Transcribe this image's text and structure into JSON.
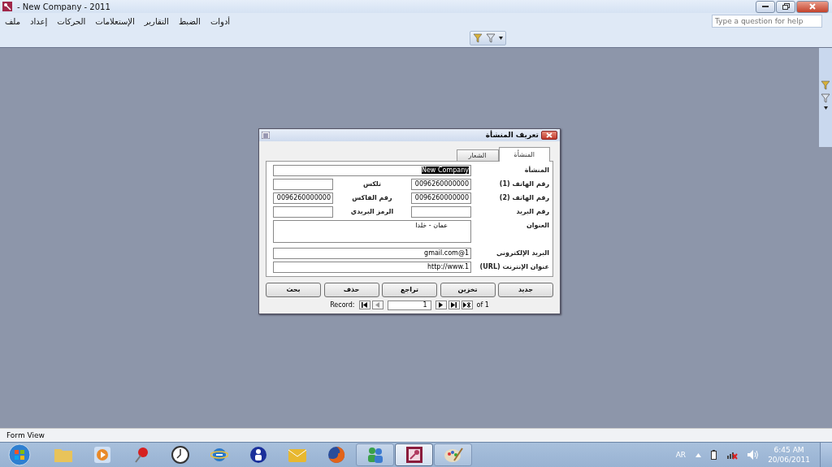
{
  "window": {
    "title": "- New Company - 2011"
  },
  "menu": [
    "أدوات",
    "الضبط",
    "التقارير",
    "الإستعلامات",
    "الحركات",
    "إعداد",
    "ملف"
  ],
  "help": {
    "placeholder": "Type a question for help"
  },
  "form": {
    "title": "تعريف المنشأة",
    "tabs": [
      {
        "label": "المنشأة",
        "selected": true
      },
      {
        "label": "الشعار",
        "selected": false
      }
    ],
    "rows": [
      {
        "kind": "wide",
        "label": "المنشأة",
        "value": "New Company",
        "text_selected": true
      },
      {
        "kind": "pair",
        "fields": [
          {
            "label": "رقم الهاتف (1)",
            "value": "0096260000000"
          },
          {
            "label": "تلكس"
          }
        ]
      },
      {
        "kind": "pair",
        "fields": [
          {
            "label": "رقم الهاتف (2)",
            "value": "0096260000000"
          },
          {
            "label": "رقم الفاكس",
            "value": "0096260000000"
          }
        ]
      },
      {
        "kind": "pair",
        "fields": [
          {
            "label": "رقم البريد"
          },
          {
            "label": "الرمز البريدي"
          }
        ]
      },
      {
        "kind": "multiline",
        "label": "العنوان",
        "value": "عمان - خلدا"
      },
      {
        "kind": "wide",
        "label": "البريد الإلكتروني",
        "value": "gmail.com@1",
        "text_selected": false
      },
      {
        "kind": "wide",
        "label": "عنوان الإنترنت (URL)",
        "value": "http://www.1",
        "text_selected": false
      }
    ],
    "buttons": [
      "جديد",
      "تخزين",
      "تراجع",
      "حذف",
      "بحث"
    ],
    "record": {
      "label": "Record:",
      "value": "1",
      "total": "of 1"
    }
  },
  "status_bar": "Form View",
  "taskbar": [
    {
      "kind": "folder",
      "running": false,
      "selected": false
    },
    {
      "kind": "media",
      "running": false,
      "selected": false
    },
    {
      "kind": "pin",
      "running": false,
      "selected": false
    },
    {
      "kind": "clock",
      "running": false,
      "selected": false
    },
    {
      "kind": "browser",
      "running": false,
      "selected": false
    },
    {
      "kind": "user",
      "running": false,
      "selected": false
    },
    {
      "kind": "mail",
      "running": false,
      "selected": false
    },
    {
      "kind": "firefox",
      "running": false,
      "selected": false
    },
    {
      "kind": "messenger",
      "running": true,
      "selected": false
    },
    {
      "kind": "access",
      "running": true,
      "selected": true
    },
    {
      "kind": "paint",
      "running": true,
      "selected": false
    }
  ],
  "tray": {
    "language": "AR",
    "time": "6:45 AM",
    "date": "20/06/2011"
  }
}
